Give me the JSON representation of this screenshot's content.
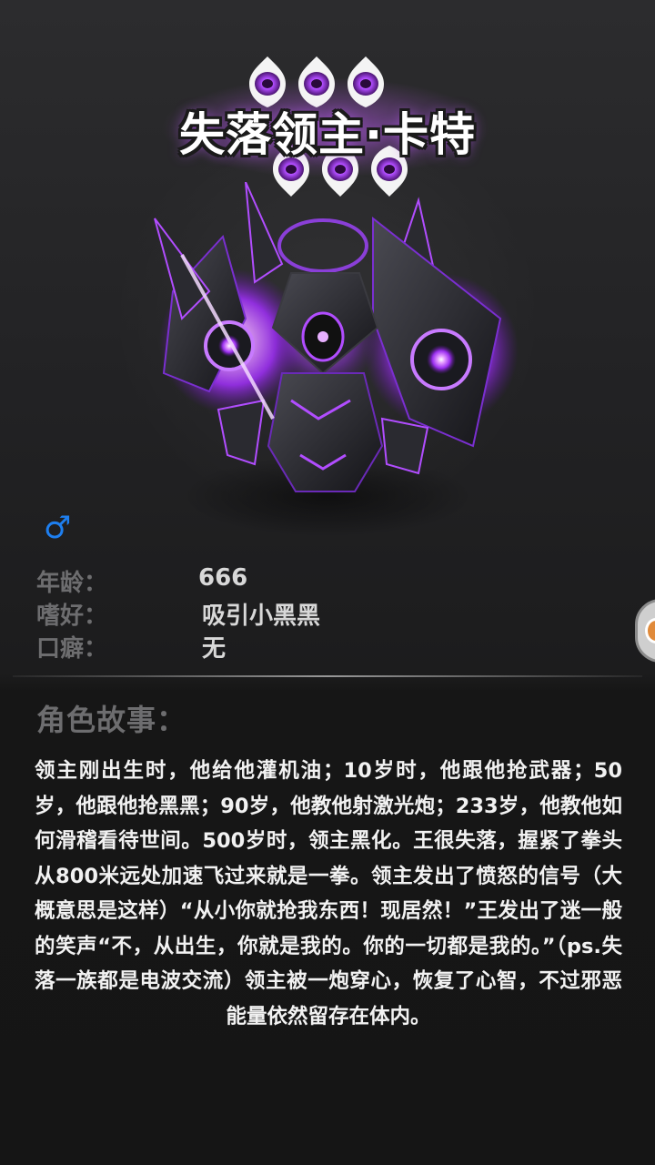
{
  "profile": {
    "name": "失落领主·卡特",
    "gender_symbol": "♂",
    "age_label": "年龄：",
    "age_value": "666",
    "hobby_label": "嗜好：",
    "hobby_value": "吸引小黑黑",
    "catchphrase_label": "口癖：",
    "catchphrase_value": "无"
  },
  "story": {
    "heading": "角色故事：",
    "text": "领主刚出生时，他给他灌机油；10岁时，他跟他抢武器；50岁，他跟他抢黑黑；90岁，他教他射激光炮；233岁，他教他如何滑稽看待世间。500岁时，领主黑化。王很失落，握紧了拳头从800米远处加速飞过来就是一拳。领主发出了愤怒的信号（大概意思是这样）“从小你就抢我东西！现居然！”王发出了迷一般的笑声“不，从出生，你就是我的。你的一切都是我的。”（ps.失落一族都是电波交流）领主被一炮穿心，恢复了心智，不过邪恶能量依然留存在体内。"
  },
  "colors": {
    "accent_purple": "#b14dff",
    "gender_blue": "#1e7ff0",
    "label_gray": "#6d6d6f",
    "text_white": "#f2f2f2",
    "background": "#1c1c1d"
  },
  "icons": {
    "rank_gem": "purple-eye-gem-icon",
    "gender": "male-symbol-icon",
    "side_tab": "side-menu-tab-icon"
  },
  "rank": {
    "gem_count": 6
  }
}
